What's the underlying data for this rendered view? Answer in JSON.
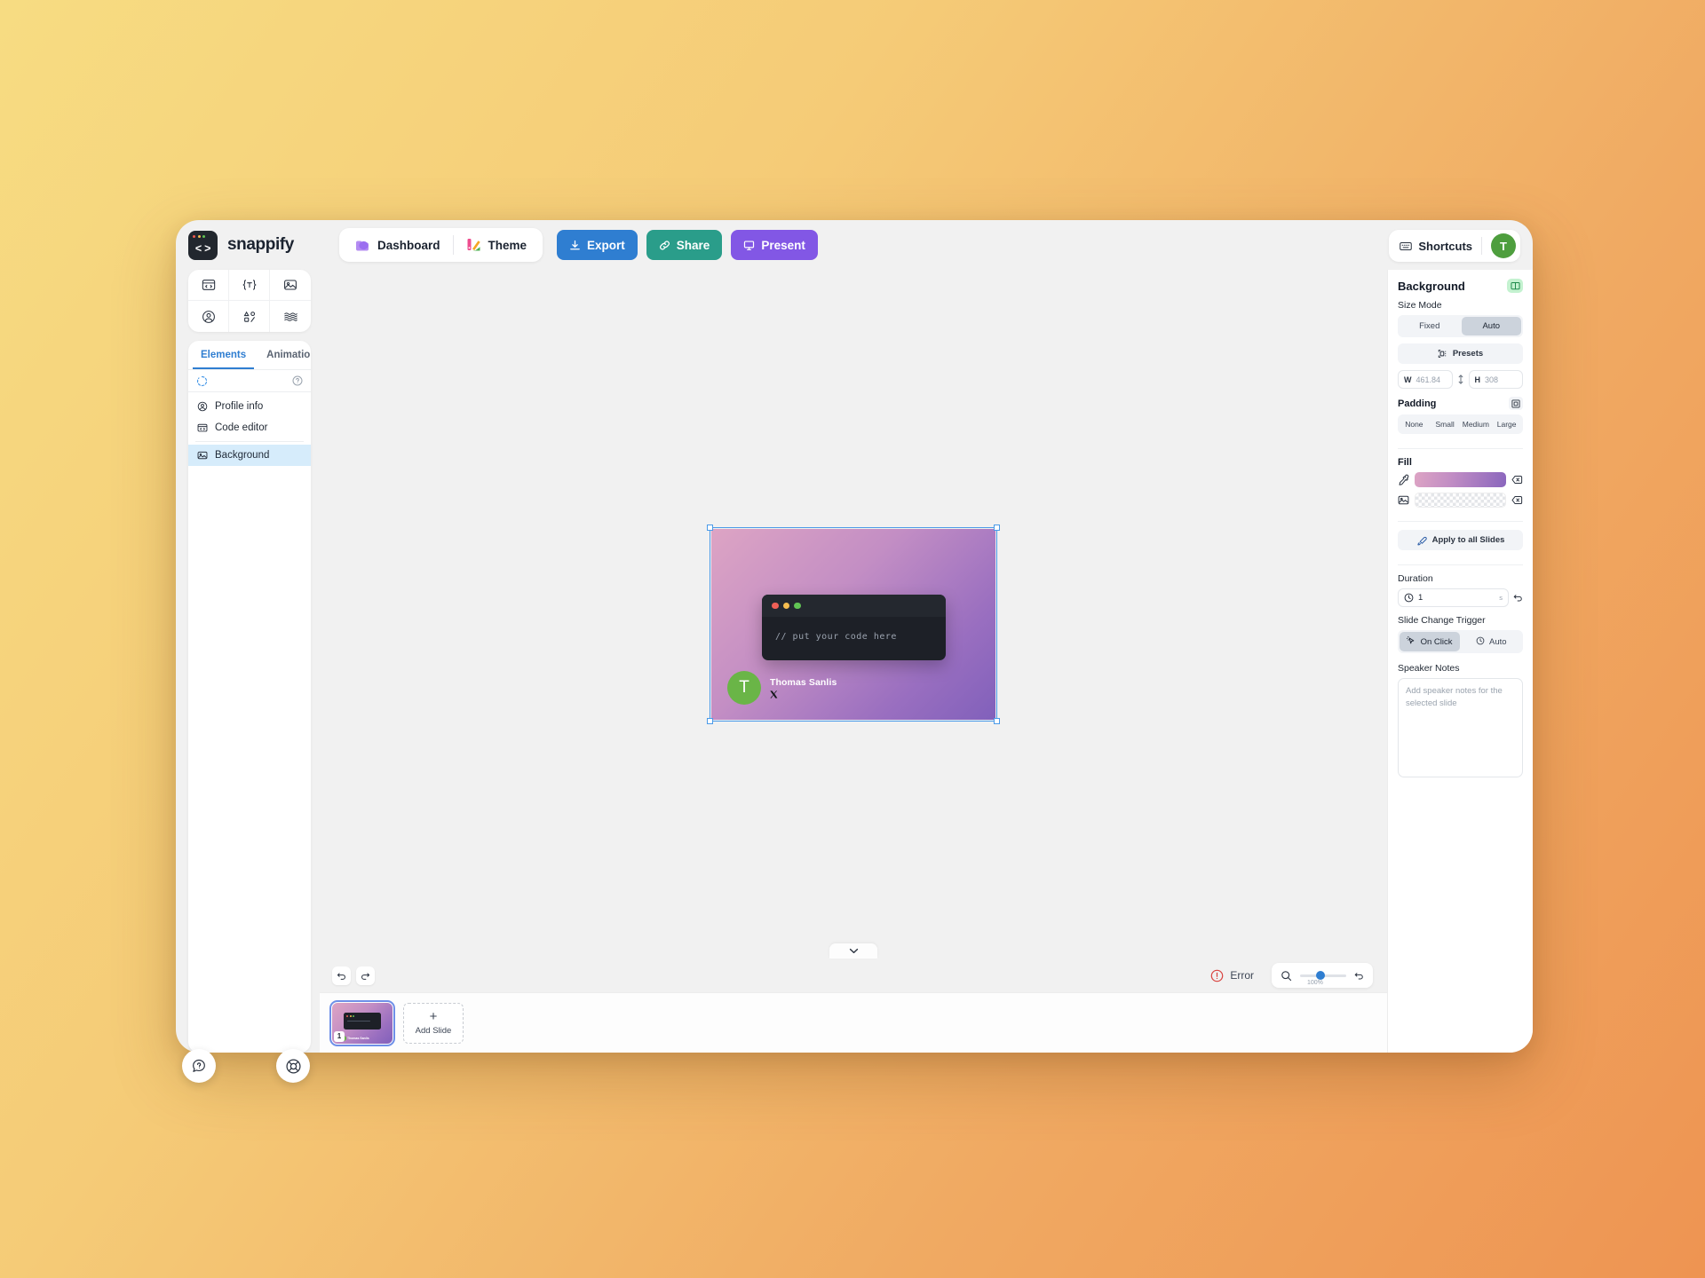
{
  "app": {
    "brand_name": "snappify",
    "brand_logo_text": "< >"
  },
  "topbar": {
    "nav": [
      {
        "label": "Dashboard",
        "icon": "folder-icon"
      },
      {
        "label": "Theme",
        "icon": "palette-icon"
      }
    ],
    "actions": [
      {
        "label": "Export",
        "icon": "download-icon",
        "color": "#2f7ed1"
      },
      {
        "label": "Share",
        "icon": "link-icon",
        "color": "#2a9d8a"
      },
      {
        "label": "Present",
        "icon": "presentation-icon",
        "color": "#8257e5"
      }
    ],
    "shortcuts_label": "Shortcuts",
    "avatar_initial": "T"
  },
  "left_sidebar": {
    "tools": [
      "code-window-icon",
      "text-icon",
      "image-icon",
      "profile-icon",
      "shapes-icon",
      "pattern-icon"
    ],
    "tabs": [
      {
        "label": "Elements",
        "active": true
      },
      {
        "label": "Animations",
        "active": false
      }
    ],
    "tab_badge_icon": "book-icon",
    "search_icon": "loading-icon",
    "help_icon": "question-icon",
    "elements": [
      {
        "label": "Profile info",
        "icon": "profile-icon",
        "selected": false
      },
      {
        "label": "Code editor",
        "icon": "code-window-icon",
        "selected": false
      },
      {
        "label": "Background",
        "icon": "background-icon",
        "selected": true
      }
    ]
  },
  "slide": {
    "code_text": "// put your code here",
    "author_name": "Thomas Sanlis",
    "author_handle_icon": "x-twitter-icon",
    "avatar_initial": "T",
    "gradient_from": "#dda4c4",
    "gradient_to": "#8160bb"
  },
  "canvas_footer": {
    "undo_icon": "undo-icon",
    "redo_icon": "redo-icon",
    "collapse_icon": "chevron-down-icon",
    "error_label": "Error",
    "error_icon": "error-circle-icon",
    "zoom_icon": "magnifier-icon",
    "zoom_level": "100%",
    "zoom_reset_icon": "reset-icon"
  },
  "slides_strip": {
    "slide_number": "1",
    "add_slide_label": "Add Slide",
    "add_slide_plus": "+"
  },
  "right_panel": {
    "title": "Background",
    "badge_icon": "book-icon",
    "size_mode_label": "Size Mode",
    "size_mode_options": [
      {
        "label": "Fixed",
        "selected": false
      },
      {
        "label": "Auto",
        "selected": true
      }
    ],
    "presets_label": "Presets",
    "presets_icon": "presets-icon",
    "width_key": "W",
    "width_value": "461.84",
    "height_key": "H",
    "height_value": "308",
    "link_icon": "link-ratio-icon",
    "padding_label": "Padding",
    "padding_icon": "padding-icon",
    "padding_options": [
      {
        "label": "None",
        "selected": false
      },
      {
        "label": "Small",
        "selected": false
      },
      {
        "label": "Medium",
        "selected": false
      },
      {
        "label": "Large",
        "selected": false
      }
    ],
    "fill_label": "Fill",
    "fill_color_icon": "eyedropper-icon",
    "fill_image_icon": "image-icon",
    "fill_clear_icon": "clear-icon",
    "fill_gradient_from": "#dda4c4",
    "fill_gradient_to": "#8a66bd",
    "apply_all_label": "Apply to all Slides",
    "apply_all_icon": "paint-icon",
    "duration_label": "Duration",
    "duration_icon": "clock-icon",
    "duration_value": "1",
    "duration_unit": "s",
    "duration_reset_icon": "reset-icon",
    "trigger_label": "Slide Change Trigger",
    "trigger_options": [
      {
        "label": "On Click",
        "icon": "cursor-click-icon",
        "selected": true
      },
      {
        "label": "Auto",
        "icon": "clock-icon",
        "selected": false
      }
    ],
    "notes_label": "Speaker Notes",
    "notes_placeholder": "Add speaker notes for the selected slide"
  },
  "floating": {
    "chat_icon": "chat-help-icon",
    "support_icon": "lifebuoy-icon"
  }
}
